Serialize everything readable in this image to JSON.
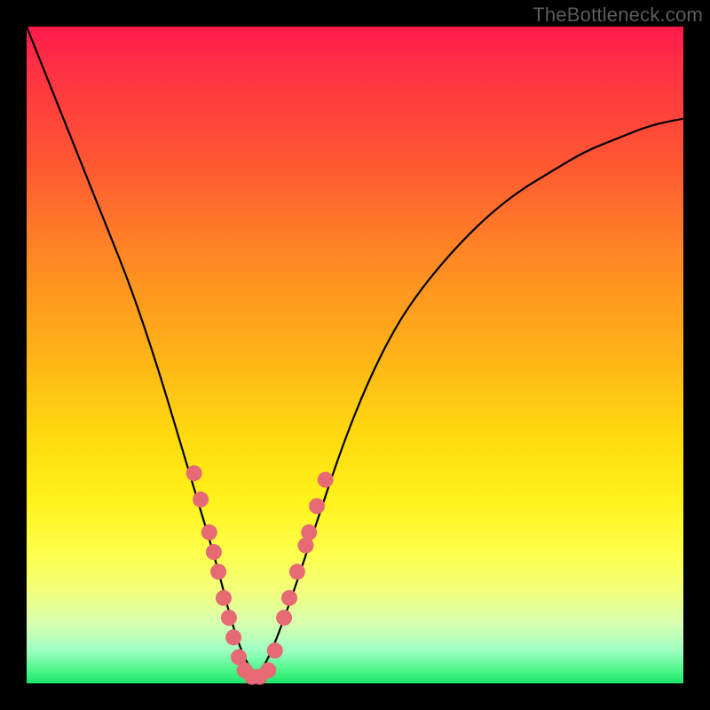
{
  "watermark": "TheBottleneck.com",
  "chart_data": {
    "type": "line",
    "title": "",
    "xlabel": "",
    "ylabel": "",
    "xlim": [
      0,
      100
    ],
    "ylim": [
      0,
      100
    ],
    "series": [
      {
        "name": "bottleneck-curve",
        "x": [
          0,
          4,
          8,
          12,
          16,
          20,
          23,
          26,
          29,
          31,
          33,
          35,
          37,
          40,
          44,
          48,
          52,
          56,
          60,
          65,
          70,
          75,
          80,
          85,
          90,
          95,
          100
        ],
        "y": [
          100,
          90,
          80,
          70,
          60,
          48,
          38,
          28,
          18,
          10,
          4,
          1,
          4,
          12,
          24,
          36,
          46,
          54,
          60,
          66,
          71,
          75,
          78,
          81,
          83,
          85,
          86
        ]
      }
    ],
    "markers": {
      "name": "highlighted-points",
      "color": "#e66a74",
      "radius": 9,
      "points": [
        {
          "x": 25.5,
          "y": 32
        },
        {
          "x": 26.5,
          "y": 28
        },
        {
          "x": 27.8,
          "y": 23
        },
        {
          "x": 28.5,
          "y": 20
        },
        {
          "x": 29.2,
          "y": 17
        },
        {
          "x": 30.0,
          "y": 13
        },
        {
          "x": 30.8,
          "y": 10
        },
        {
          "x": 31.5,
          "y": 7
        },
        {
          "x": 32.3,
          "y": 4
        },
        {
          "x": 33.2,
          "y": 2
        },
        {
          "x": 34.3,
          "y": 1
        },
        {
          "x": 35.5,
          "y": 1
        },
        {
          "x": 36.8,
          "y": 2
        },
        {
          "x": 37.8,
          "y": 5
        },
        {
          "x": 39.2,
          "y": 10
        },
        {
          "x": 40.0,
          "y": 13
        },
        {
          "x": 41.2,
          "y": 17
        },
        {
          "x": 42.5,
          "y": 21
        },
        {
          "x": 43.0,
          "y": 23
        },
        {
          "x": 44.2,
          "y": 27
        },
        {
          "x": 45.5,
          "y": 31
        }
      ]
    }
  }
}
